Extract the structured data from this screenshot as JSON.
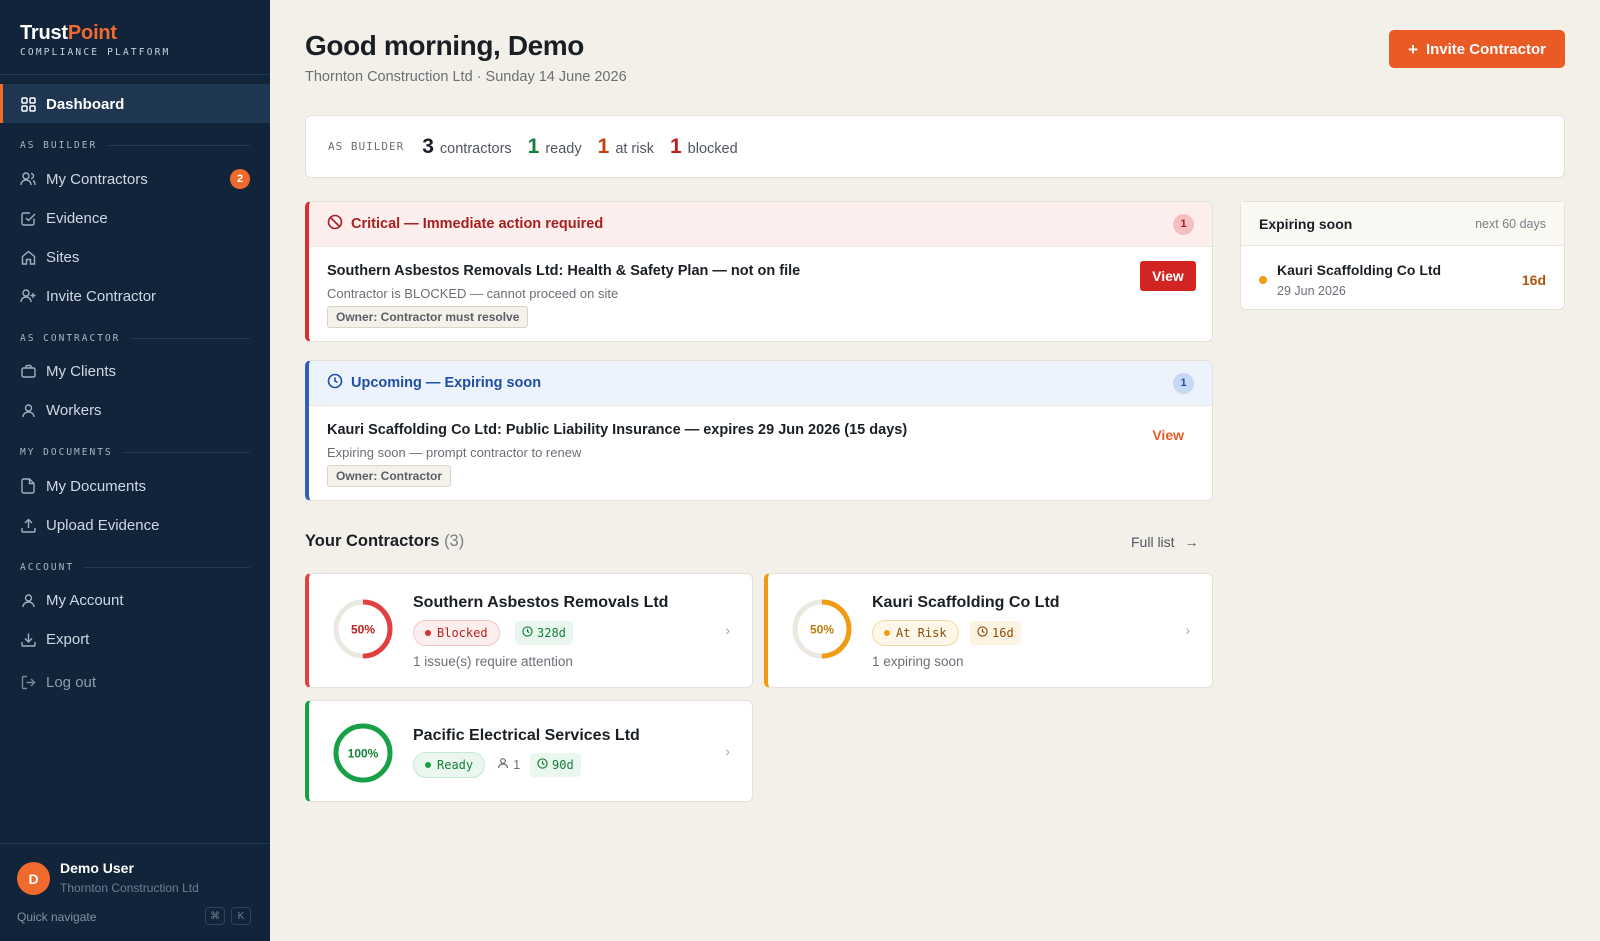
{
  "sidebar": {
    "brand_main": "Trust",
    "brand_accent": "Point",
    "brand_sub": "COMPLIANCE PLATFORM",
    "dashboard": "Dashboard",
    "sections": {
      "builder": "AS BUILDER",
      "contractor": "AS CONTRACTOR",
      "documents": "MY DOCUMENTS",
      "account": "ACCOUNT"
    },
    "items": {
      "my_contractors": "My Contractors",
      "my_contractors_badge": "2",
      "evidence": "Evidence",
      "sites": "Sites",
      "invite_contractor": "Invite Contractor",
      "my_clients": "My Clients",
      "workers": "Workers",
      "my_documents": "My Documents",
      "upload_evidence": "Upload Evidence",
      "my_account": "My Account",
      "export": "Export",
      "log_out": "Log out"
    },
    "user": {
      "initial": "D",
      "name": "Demo User",
      "org": "Thornton Construction Ltd",
      "quick_nav": "Quick navigate",
      "kbd1": "⌘",
      "kbd2": "K"
    }
  },
  "header": {
    "greeting": "Good morning, Demo",
    "subtitle": "Thornton Construction Ltd · Sunday 14 June 2026",
    "invite_button": "Invite Contractor"
  },
  "stats": {
    "label": "AS BUILDER",
    "contractors_num": "3",
    "contractors_lbl": "contractors",
    "ready_num": "1",
    "ready_lbl": "ready",
    "risk_num": "1",
    "risk_lbl": "at risk",
    "blocked_num": "1",
    "blocked_lbl": "blocked",
    "colors": {
      "ready": "#15803d",
      "risk": "#c2410c",
      "blocked": "#c21d1d"
    }
  },
  "critical": {
    "title": "Critical — Immediate action required",
    "count": "1",
    "issue_title": "Southern Asbestos Removals Ltd: Health & Safety Plan — not on file",
    "issue_desc": "Contractor is BLOCKED — cannot proceed on site",
    "owner": "Owner: Contractor must resolve",
    "view": "View"
  },
  "upcoming": {
    "title": "Upcoming — Expiring soon",
    "count": "1",
    "issue_title": "Kauri Scaffolding Co Ltd: Public Liability Insurance — expires 29 Jun 2026 (15 days)",
    "issue_desc": "Expiring soon — prompt contractor to renew",
    "owner": "Owner: Contractor",
    "view": "View"
  },
  "expiring": {
    "title": "Expiring soon",
    "subtitle": "next 60 days",
    "name": "Kauri Scaffolding Co Ltd",
    "date": "29 Jun 2026",
    "days": "16d"
  },
  "contractors": {
    "title": "Your Contractors",
    "count": "(3)",
    "full_list": "Full list",
    "items": [
      {
        "name": "Southern Asbestos Removals Ltd",
        "percent": "50%",
        "progress": 0.5,
        "status": "Blocked",
        "days": "328d",
        "note": "1 issue(s) require attention"
      },
      {
        "name": "Kauri Scaffolding Co Ltd",
        "percent": "50%",
        "progress": 0.5,
        "status": "At Risk",
        "days": "16d",
        "note": "1 expiring soon"
      },
      {
        "name": "Pacific Electrical Services Ltd",
        "percent": "100%",
        "progress": 1.0,
        "status": "Ready",
        "workers": "1",
        "days": "90d"
      }
    ]
  }
}
